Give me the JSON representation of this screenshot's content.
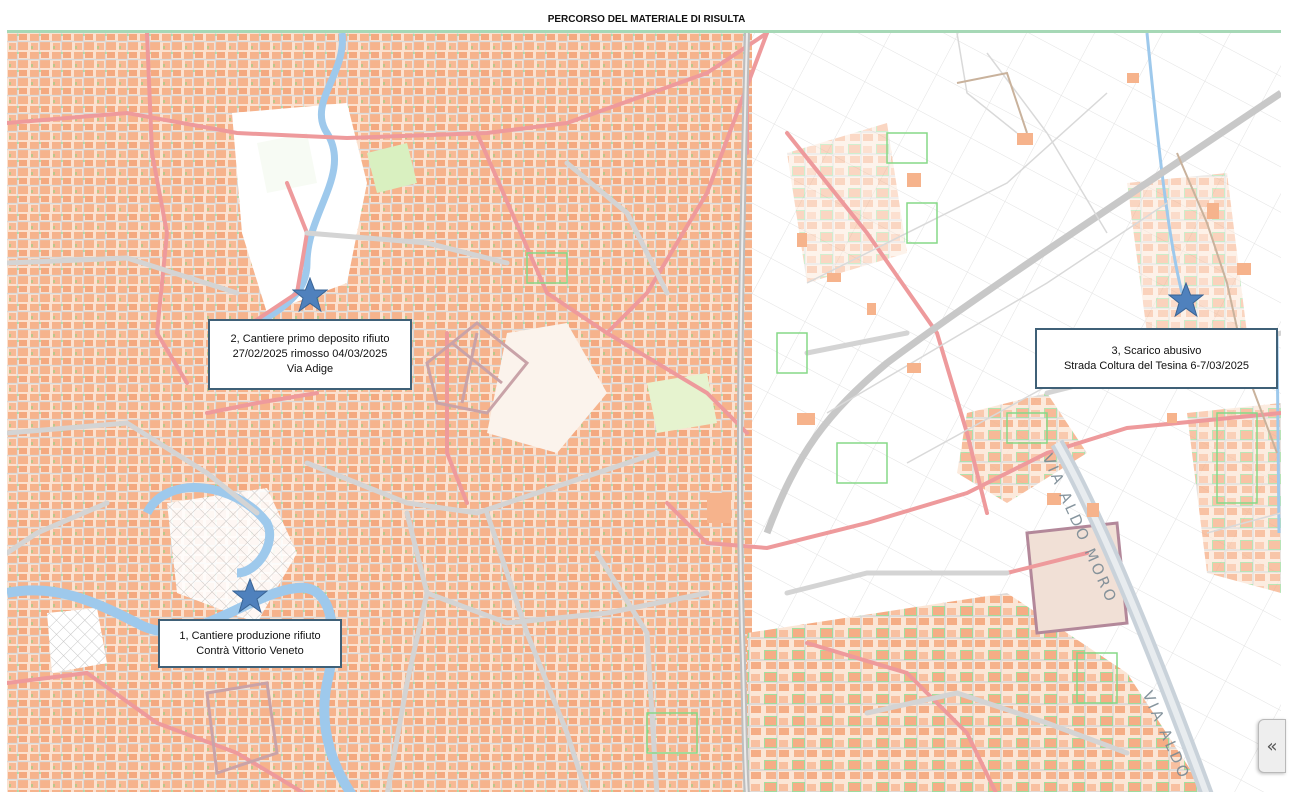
{
  "title": "PERCORSO DEL MATERIALE DI RISULTA",
  "markers": [
    {
      "id": 1,
      "line1": "1, Cantiere produzione rifiuto",
      "line2": "Contrà Vittorio Veneto",
      "line3": ""
    },
    {
      "id": 2,
      "line1": "2, Cantiere primo deposito rifiuto",
      "line2": "27/02/2025 rimosso 04/03/2025",
      "line3": "Via Adige"
    },
    {
      "id": 3,
      "line1": "3, Scarico abusivo",
      "line2": "Strada Coltura del Tesina 6-7/03/2025",
      "line3": ""
    }
  ],
  "street_labels": [
    "VIA ALDO MORO",
    "VIA ALDO"
  ],
  "collapse_button": {
    "label": "«"
  },
  "colors": {
    "building": "#f6b38c",
    "green_area": "#9fe0a0",
    "road": "#d3d3d3",
    "main_road": "#ee9a9c",
    "river": "#9ec9ec",
    "marker": "#4f81bd",
    "callout_border": "#3f6077"
  }
}
